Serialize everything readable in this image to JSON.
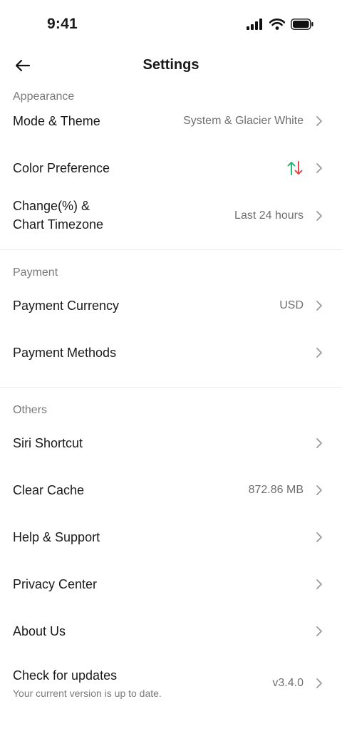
{
  "status_bar": {
    "time": "9:41",
    "icons": [
      "cellular-signal-icon",
      "wifi-icon",
      "battery-icon"
    ]
  },
  "header": {
    "title": "Settings",
    "back_icon": "arrow-left-icon"
  },
  "sections": {
    "appearance": {
      "label": "Appearance",
      "mode_theme": {
        "label": "Mode & Theme",
        "value": "System & Glacier White"
      },
      "color_preference": {
        "label": "Color Preference",
        "icon": "up-down-arrows-icon",
        "up_color": "#2bb673",
        "down_color": "#e5484d"
      },
      "change_timezone": {
        "label_line1": "Change(%) &",
        "label_line2": "Chart Timezone",
        "value": "Last 24 hours"
      }
    },
    "payment": {
      "label": "Payment",
      "payment_currency": {
        "label": "Payment Currency",
        "value": "USD"
      },
      "payment_methods": {
        "label": "Payment Methods"
      }
    },
    "others": {
      "label": "Others",
      "siri_shortcut": {
        "label": "Siri Shortcut"
      },
      "clear_cache": {
        "label": "Clear Cache",
        "value": "872.86 MB"
      },
      "help_support": {
        "label": "Help & Support"
      },
      "privacy_center": {
        "label": "Privacy Center"
      },
      "about_us": {
        "label": "About Us"
      },
      "check_updates": {
        "label": "Check for updates",
        "subtitle": "Your current version is up to date.",
        "value": "v3.4.0"
      }
    }
  },
  "colors": {
    "text_primary": "#1a1a1a",
    "text_secondary": "#7a7a7a",
    "divider": "#ececec",
    "chevron": "#9a9a9a"
  }
}
